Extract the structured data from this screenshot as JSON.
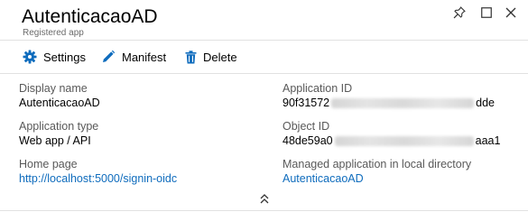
{
  "header": {
    "title": "AutenticacaoAD",
    "subtitle": "Registered app",
    "icons": [
      "pin-icon",
      "maximize-icon",
      "close-icon"
    ]
  },
  "toolbar": {
    "settings_label": "Settings",
    "manifest_label": "Manifest",
    "delete_label": "Delete"
  },
  "essentials": {
    "display_name": {
      "label": "Display name",
      "value": "AutenticacaoAD"
    },
    "application_type": {
      "label": "Application type",
      "value": "Web app / API"
    },
    "home_page": {
      "label": "Home page",
      "value": "http://localhost:5000/signin-oidc"
    },
    "application_id": {
      "label": "Application ID",
      "value_start": "90f31572",
      "value_end": "dde"
    },
    "object_id": {
      "label": "Object ID",
      "value_start": "48de59a0",
      "value_end": "aaa1"
    },
    "managed_application": {
      "label": "Managed application in local directory",
      "value": "AutenticacaoAD"
    }
  },
  "colors": {
    "accent": "#0f6cbd",
    "label": "#595959",
    "divider": "#e1e1e1"
  }
}
